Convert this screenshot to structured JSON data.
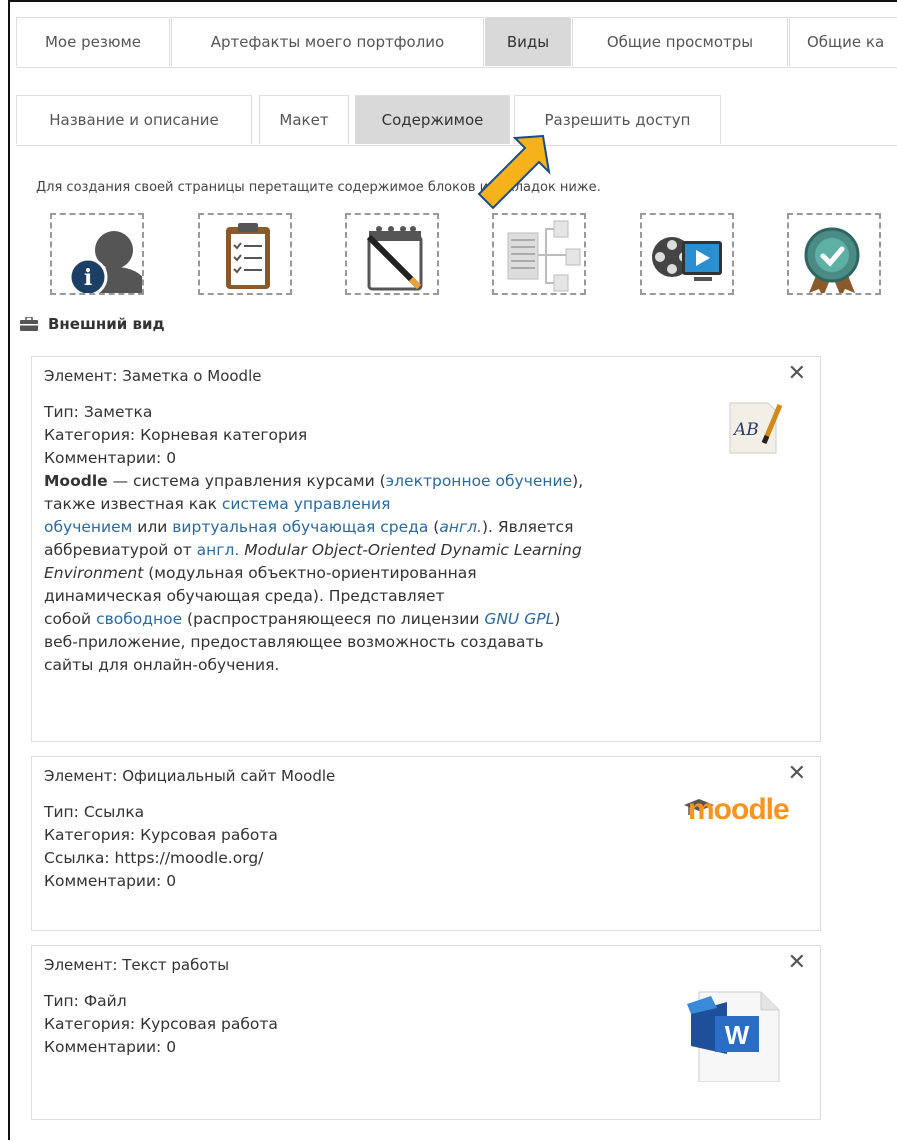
{
  "top_tabs": [
    {
      "label": "Мое резюме",
      "active": false
    },
    {
      "label": "Артефакты моего портфолио",
      "active": false
    },
    {
      "label": "Виды",
      "active": true
    },
    {
      "label": "Общие просмотры",
      "active": false
    },
    {
      "label": "Общие ка",
      "active": false
    }
  ],
  "sub_tabs": [
    {
      "label": "Название и описание",
      "active": false
    },
    {
      "label": "Макет",
      "active": false
    },
    {
      "label": "Содержимое",
      "active": true
    },
    {
      "label": "Разрешить доступ",
      "active": false
    }
  ],
  "hint": "Для создания своей страницы перетащите содержимое блоков из вкладок ниже.",
  "palette": [
    {
      "icon": "user-info-icon"
    },
    {
      "icon": "clipboard-checklist-icon"
    },
    {
      "icon": "notepad-pencil-icon"
    },
    {
      "icon": "table-hierarchy-icon"
    },
    {
      "icon": "film-reel-video-icon"
    },
    {
      "icon": "badge-check-icon"
    }
  ],
  "section_title": "Внешний вид",
  "blocks": [
    {
      "title": "Элемент: Заметка о Moodle",
      "type": "Тип: Заметка",
      "category": "Категория: Корневая категория",
      "comments": "Комментарии: 0",
      "text": {
        "bold": "Moodle",
        "t1": " — система управления курсами (",
        "l1": "электронное обучение",
        "t2": "),",
        "t3": "также известная как ",
        "l2": "система управления",
        "l3": "обучением",
        "t4": " или ",
        "l4": "виртуальная обучающая среда",
        "t5": " (",
        "l5": "англ.",
        "t6": "). Является",
        "t7": "аббревиатурой от ",
        "l6": "англ.",
        "t8": " Modular Object-Oriented Dynamic Learning",
        "t9": "Environment",
        "t10": " (модульная объектно-ориентированная",
        "t11": "динамическая обучающая среда). Представляет",
        "t12": "собой ",
        "l7": "свободное",
        "t13": " (распространяющееся по лицензии ",
        "l8": "GNU GPL",
        "t14": ")",
        "t15": "веб-приложение, предоставляющее возможность создавать",
        "t16": "сайты для онлайн-обучения."
      },
      "icon": "ab-note-icon"
    },
    {
      "title": "Элемент: Официальный сайт Moodle",
      "type": "Тип: Ссылка",
      "category": "Категория: Курсовая работа",
      "link": "Ссылка: https://moodle.org/",
      "comments": "Комментарии: 0",
      "logo_text": "moodle",
      "icon": "moodle-logo-icon"
    },
    {
      "title": "Элемент: Текст работы",
      "type": "Тип: Файл",
      "category": "Категория: Курсовая работа",
      "comments": "Комментарии: 0",
      "icon": "word-document-icon"
    }
  ],
  "close_symbol": "✕",
  "colors": {
    "active_tab": "#d9d9d9",
    "link": "#2a6aa0",
    "arrow": "#f5b21b",
    "moodle_orange": "#f7931e"
  }
}
